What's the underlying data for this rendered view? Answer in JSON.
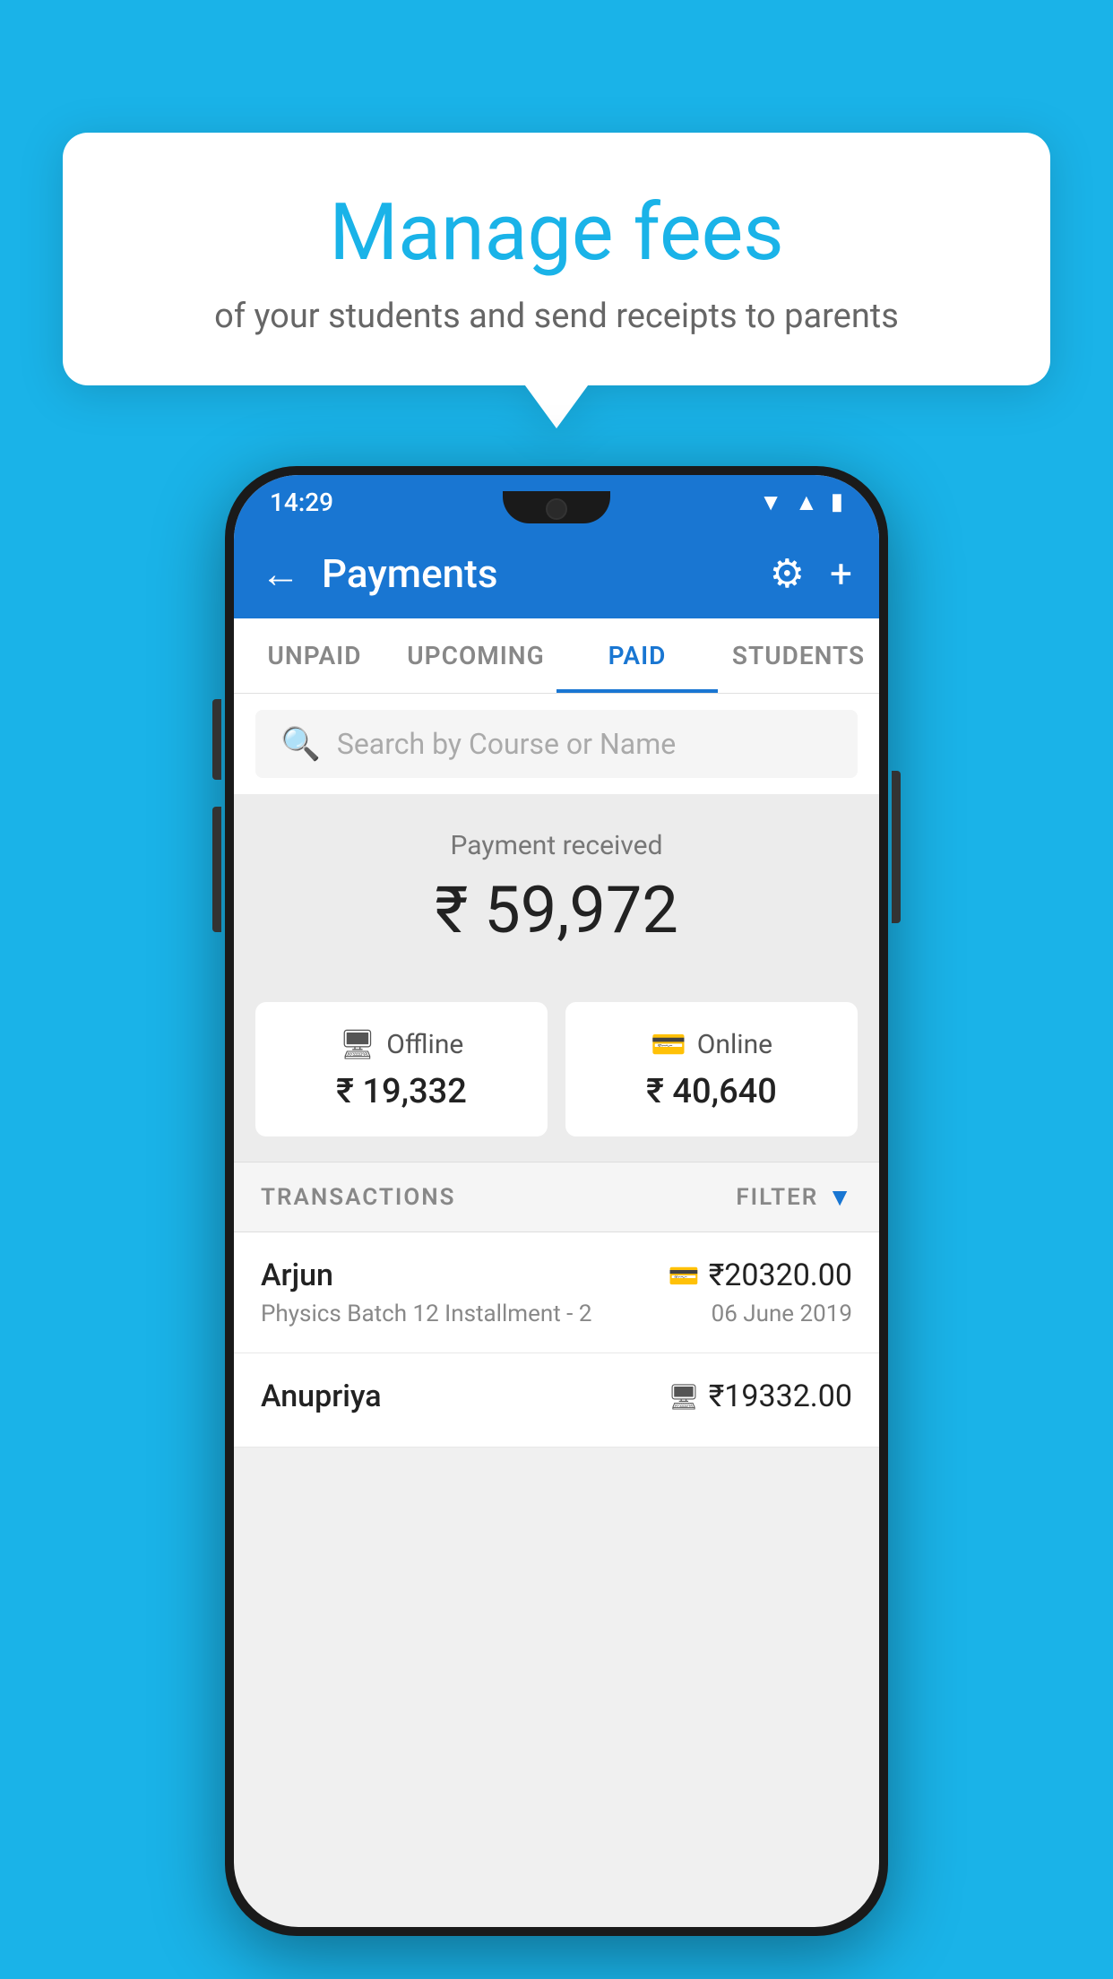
{
  "page": {
    "background_color": "#1ab3e8"
  },
  "speech_bubble": {
    "title": "Manage fees",
    "subtitle": "of your students and send receipts to parents"
  },
  "status_bar": {
    "time": "14:29",
    "wifi_icon": "▲",
    "signal_icon": "▲",
    "battery_icon": "▮"
  },
  "app_bar": {
    "title": "Payments",
    "back_label": "←",
    "gear_label": "⚙",
    "plus_label": "+"
  },
  "tabs": [
    {
      "label": "UNPAID",
      "active": false
    },
    {
      "label": "UPCOMING",
      "active": false
    },
    {
      "label": "PAID",
      "active": true
    },
    {
      "label": "STUDENTS",
      "active": false
    }
  ],
  "search": {
    "placeholder": "Search by Course or Name"
  },
  "payment_received": {
    "label": "Payment received",
    "amount": "₹ 59,972"
  },
  "payment_cards": [
    {
      "icon": "💳",
      "label": "Offline",
      "amount": "₹ 19,332"
    },
    {
      "icon": "💳",
      "label": "Online",
      "amount": "₹ 40,640"
    }
  ],
  "transactions_section": {
    "label": "TRANSACTIONS",
    "filter_label": "FILTER"
  },
  "transactions": [
    {
      "name": "Arjun",
      "course": "Physics Batch 12 Installment - 2",
      "payment_icon": "💳",
      "amount": "₹20320.00",
      "date": "06 June 2019"
    },
    {
      "name": "Anupriya",
      "course": "",
      "payment_icon": "💵",
      "amount": "₹19332.00",
      "date": ""
    }
  ]
}
